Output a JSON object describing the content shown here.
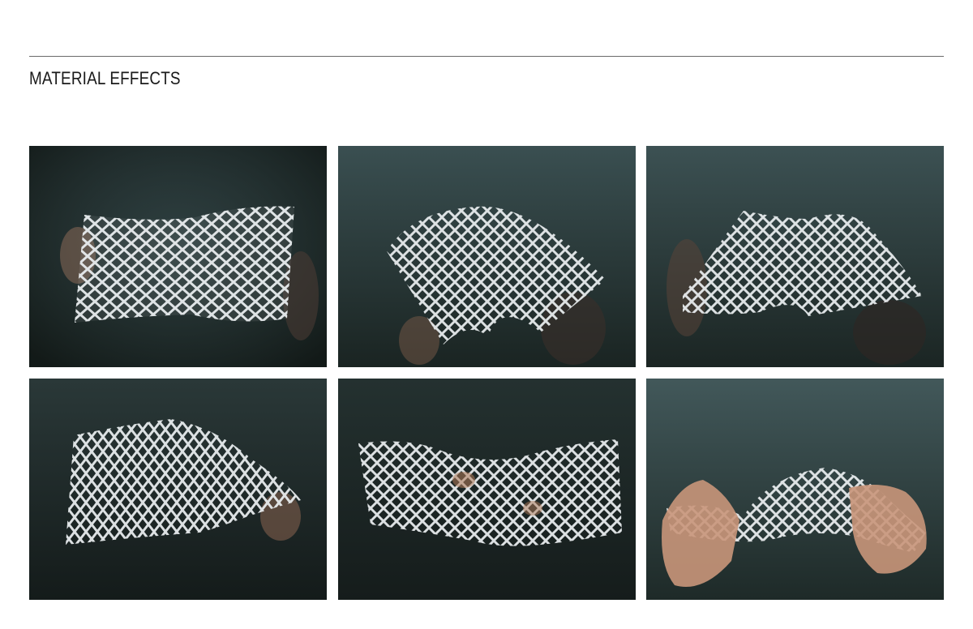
{
  "header": {
    "title": "MATERIAL EFFECTS"
  },
  "colors": {
    "background": "#ffffff",
    "rule": "#6a6a6a",
    "photo_bg_dark": "#1d2624",
    "photo_bg_teal": "#2f4446",
    "mesh": "#e6eaec",
    "skin": "#c9967a"
  },
  "gallery": {
    "photos": [
      {
        "name": "mesh-photo-flat-wave"
      },
      {
        "name": "mesh-photo-arched-fold"
      },
      {
        "name": "mesh-photo-twisted-arch"
      },
      {
        "name": "mesh-photo-curled-corner"
      },
      {
        "name": "mesh-photo-wavy-sheet"
      },
      {
        "name": "mesh-photo-hands-stretch"
      }
    ]
  }
}
